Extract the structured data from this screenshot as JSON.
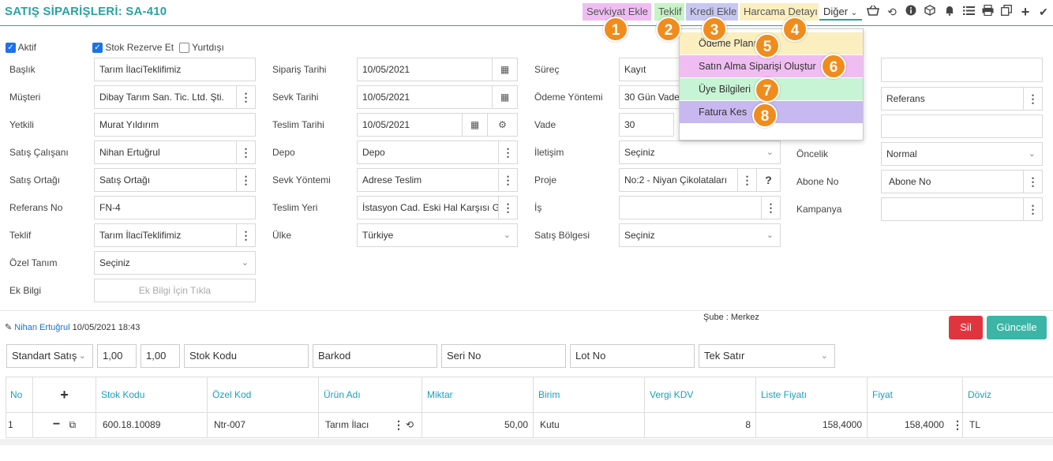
{
  "header": {
    "title": "SATIŞ SİPARİŞLERİ: SA-410",
    "buttons": {
      "sevkiyat": "Sevkiyat Ekle",
      "teklif": "Teklif",
      "kredi": "Kredi Ekle",
      "harcama": "Harcama Detayı",
      "diger": "Diğer"
    },
    "badges": [
      "1",
      "2",
      "3",
      "4",
      "5",
      "6",
      "7",
      "8"
    ]
  },
  "dropdown_menu": {
    "items": [
      "Ödeme Planı",
      "Satın Alma Siparişi Oluştur",
      "Üye Bilgileri",
      "Fatura Kes"
    ],
    "colors": [
      "#fbefbf",
      "#f0bdf3",
      "#c6f4d4",
      "#c7b8f0"
    ]
  },
  "checkboxes": {
    "aktif": "Aktif",
    "stok_rezerve": "Stok Rezerve Et",
    "yurtdisi": "Yurtdışı"
  },
  "form": {
    "col1": {
      "baslik_label": "Başlık",
      "baslik": "Tarım İlaciTeklifimiz",
      "musteri_label": "Müşteri",
      "musteri": "Dibay Tarım San. Tic. Ltd. Şti.",
      "yetkili_label": "Yetkili",
      "yetkili": "Murat Yıldırım",
      "satis_calisani_label": "Satış Çalışanı",
      "satis_calisani": "Nihan Ertuğrul",
      "satis_ortagi_label": "Satış Ortağı",
      "satis_ortagi": "Satış Ortağı",
      "referans_no_label": "Referans No",
      "referans_no": "FN-4",
      "teklif_label": "Teklif",
      "teklif": "Tarım İlaciTeklifimiz",
      "ozel_tanim_label": "Özel Tanım",
      "ozel_tanim": "Seçiniz",
      "ek_bilgi_label": "Ek Bilgi",
      "ek_bilgi_btn": "Ek Bilgi İçin Tıkla"
    },
    "col2": {
      "siparis_tarihi_label": "Sipariş Tarihi",
      "siparis_tarihi": "10/05/2021",
      "sevk_tarihi_label": "Sevk Tarihi",
      "sevk_tarihi": "10/05/2021",
      "teslim_tarihi_label": "Teslim Tarihi",
      "teslim_tarihi": "10/05/2021",
      "depo_label": "Depo",
      "depo": "Depo",
      "sevk_yontemi_label": "Sevk Yöntemi",
      "sevk_yontemi": "Adrese Teslim",
      "teslim_yeri_label": "Teslim Yeri",
      "teslim_yeri": "İstasyon Cad. Eski Hal Karşısı G",
      "ulke_label": "Ülke",
      "ulke": "Türkiye"
    },
    "col3": {
      "surec_label": "Süreç",
      "surec": "Kayıt",
      "odeme_yontemi_label": "Ödeme Yöntemi",
      "odeme_yontemi": "30 Gün Vade",
      "vade_label": "Vade",
      "vade": "30",
      "iletisim_label": "İletişim",
      "iletisim": "Seçiniz",
      "proje_label": "Proje",
      "proje": "No:2 - Niyan Çikolataları",
      "is_label": "İş",
      "is": "",
      "satis_bolgesi_label": "Satış Bölgesi",
      "satis_bolgesi": "Seçiniz"
    },
    "col4": {
      "referans": "Referans",
      "oncelik_label": "Öncelik",
      "oncelik": "Normal",
      "abone_no_label": "Abone No",
      "abone_no": "Abone No",
      "kampanya_label": "Kampanya",
      "kampanya": ""
    }
  },
  "record": {
    "user": "Nihan Ertuğrul",
    "datetime": "10/05/2021 18:43",
    "sube": "Şube : Merkez",
    "sil": "Sil",
    "guncelle": "Güncelle"
  },
  "filters": {
    "satis_tipi": "Standart Satış",
    "miktar1": "1,00",
    "miktar2": "1,00",
    "stok_kodu": "Stok Kodu",
    "barkod": "Barkod",
    "seri_no": "Seri No",
    "lot_no": "Lot No",
    "satir": "Tek Satır"
  },
  "table": {
    "headers": [
      "No",
      "+",
      "Stok Kodu",
      "Özel Kod",
      "Ürün Adı",
      "Miktar",
      "Birim",
      "Vergi KDV",
      "Liste Fiyatı",
      "Fiyat",
      "Döviz"
    ],
    "rows": [
      [
        "1",
        "",
        "600.18.10089",
        "Ntr-007",
        "Tarım İlacı",
        "50,00",
        "Kutu",
        "8",
        "158,4000",
        "158,4000",
        "TL"
      ]
    ]
  }
}
